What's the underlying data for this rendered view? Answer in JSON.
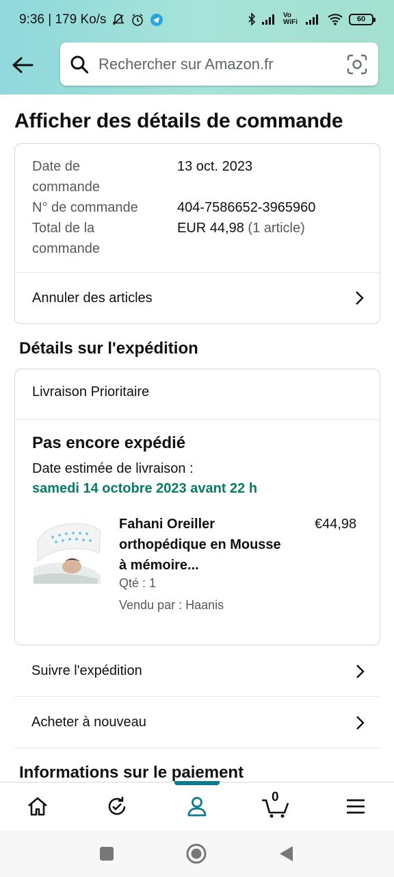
{
  "status_bar": {
    "time_speed": "9:36 | 179 Ko/s",
    "battery": "60",
    "network_label": "Vo WiFi"
  },
  "search": {
    "placeholder": "Rechercher sur Amazon.fr"
  },
  "page": {
    "title": "Afficher des détails de commande"
  },
  "order_summary": {
    "date_label": "Date de commande",
    "date_value": "13 oct. 2023",
    "number_label": "N° de commande",
    "number_value": "404-7586652-3965960",
    "total_label": "Total de la commande",
    "total_value": "EUR 44,98",
    "total_items": "(1 article)",
    "cancel_link": "Annuler des articles"
  },
  "shipping": {
    "section_title": "Détails sur l'expédition",
    "method": "Livraison Prioritaire",
    "status": "Pas encore expédié",
    "eta_label": "Date estimée de livraison :",
    "eta_date": "samedi 14 octobre 2023 avant 22 h",
    "eta_color": "#067d62"
  },
  "product": {
    "title": "Fahani Oreiller orthopédique en Mousse à mémoire...",
    "price": "€44,98",
    "qty": "Qté : 1",
    "seller": "Vendu par : Haanis"
  },
  "actions": {
    "track": "Suivre l'expédition",
    "buy_again": "Acheter à nouveau"
  },
  "payment": {
    "section_title": "Informations sur le paiement"
  },
  "bottom_nav": {
    "items": [
      "home-icon",
      "orders-refresh-icon",
      "account-icon",
      "cart-icon",
      "menu-icon"
    ],
    "active": "account-icon",
    "cart_count": "0",
    "accent": "#0b7b8b"
  }
}
